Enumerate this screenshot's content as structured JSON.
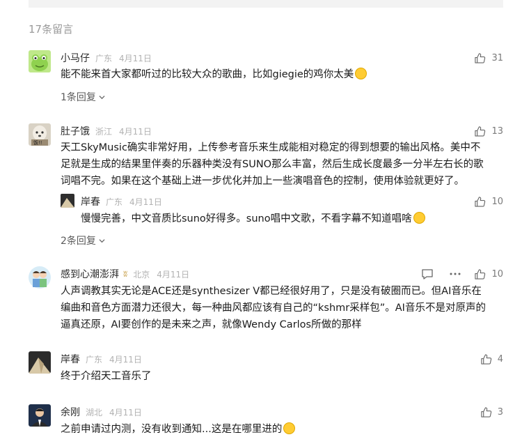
{
  "comment_count": "17条留言",
  "comments": [
    {
      "name": "小马仔",
      "region": "广东",
      "date": "4月11日",
      "likes": "31",
      "text": "能不能来首大家都听过的比较大众的歌曲，比如giegie的鸡你太美",
      "replies_label": "1条回复",
      "avatar_icon": "frog-avatar"
    },
    {
      "name": "肚子饿",
      "region": "浙江",
      "date": "4月11日",
      "likes": "13",
      "lines": [
        "天工SkyMusic确实非常好用，上传参考音乐来生成能相对稳定的得到想要的输出风格。美中不",
        "足就是生成的结果里伴奏的乐器种类没有SUNO那么丰富，然后生成长度最多一分半左右长的歌",
        "词唱不完。如果在这个基础上进一步优化并加上一些演唱音色的控制，使用体验就更好了。"
      ],
      "reply": {
        "name": "岸春",
        "region": "广东",
        "date": "4月11日",
        "likes": "10",
        "text": "慢慢完善，中文音质比suno好得多。suno唱中文歌，不看字幕不知道唱啥"
      },
      "replies_label": "2条回复",
      "avatar_icon": "dog-avatar"
    },
    {
      "name": "感到心潮澎湃",
      "region": "北京",
      "date": "4月11日",
      "likes": "10",
      "lines": [
        "人声调教其实无论是ACE还是synthesizer V都已经很好用了，只是没有破圈而已。但AI音乐在",
        "编曲和音色方面潜力还很大，每一种曲风都应该有自己的“kshmr采样包”。AI音乐不是对原声的",
        "逼真还原，AI要创作的是未来之声，就像Wendy Carlos所做的那样"
      ],
      "avatar_icon": "kids-avatar"
    },
    {
      "name": "岸春",
      "region": "广东",
      "date": "4月11日",
      "likes": "4",
      "text": "终于介绍天工音乐了",
      "avatar_icon": "dark-avatar"
    },
    {
      "name": "余刚",
      "region": "湖北",
      "date": "4月11日",
      "likes": "3",
      "text": "之前申请过内测，没有收到通知...这是在哪里进的",
      "avatar_icon": "man-avatar"
    }
  ],
  "colors": {
    "meta": "#b2b2b2",
    "text": "#1a1a1a",
    "vip": "#c9a24e"
  }
}
